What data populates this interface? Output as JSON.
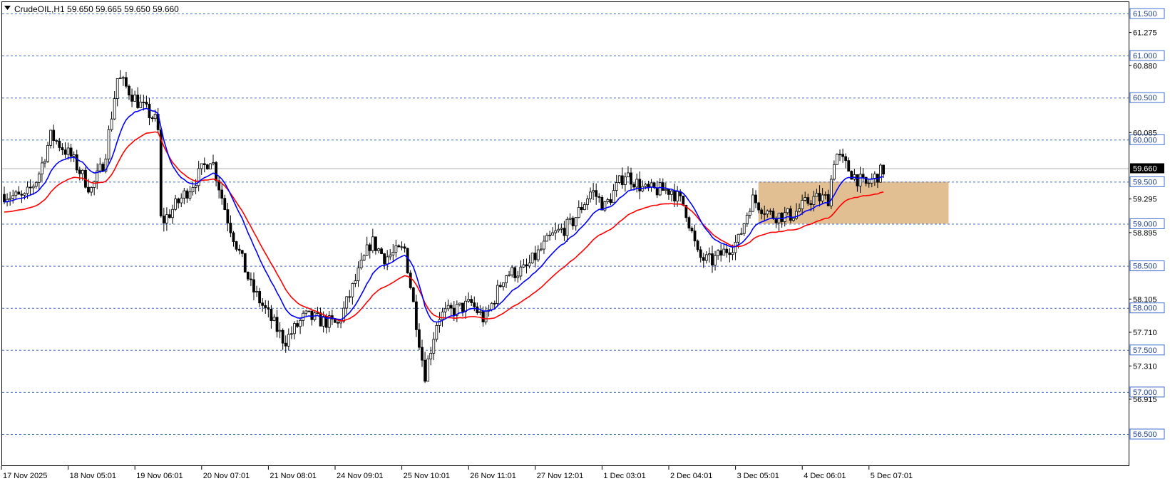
{
  "header": {
    "title": "CrudeOIL,H1  59.650 59.665 59.650 59.660"
  },
  "colors": {
    "background": "#ffffff",
    "candle_body": "#000000",
    "fast_ma": "#0000ff",
    "slow_ma": "#ff0000",
    "level_line": "#3f6fd1",
    "zone_fill": "#deb887",
    "current_price_label_bg": "#000000"
  },
  "chart_data": {
    "type": "candlestick",
    "symbol": "CrudeOIL",
    "timeframe": "H1",
    "ohlc_header": {
      "open": 59.65,
      "high": 59.665,
      "low": 59.65,
      "close": 59.66
    },
    "current_price": 59.66,
    "ylim": [
      56.4,
      61.6
    ],
    "y_tick_labels": [
      "61.275",
      "60.880",
      "60.085",
      "59.295",
      "58.895",
      "58.105",
      "57.710",
      "57.310",
      "56.915"
    ],
    "level_lines": [
      "61.500",
      "61.000",
      "60.500",
      "60.000",
      "59.500",
      "59.000",
      "58.500",
      "58.000",
      "57.500",
      "57.000",
      "56.500"
    ],
    "x_tick_labels": [
      "17 Nov 2025",
      "18 Nov 05:01",
      "19 Nov 06:01",
      "20 Nov 07:01",
      "21 Nov 08:01",
      "24 Nov 09:01",
      "25 Nov 10:01",
      "26 Nov 11:01",
      "27 Nov 12:01",
      "1 Dec 03:01",
      "2 Dec 04:01",
      "3 Dec 05:01",
      "4 Dec 06:01",
      "5 Dec 07:01"
    ],
    "grid": false,
    "zone": {
      "from": "3 Dec 12:01",
      "to": "6 Dec 07:01",
      "low": 59.0,
      "high": 59.5
    },
    "close_path": [
      {
        "t": 0,
        "v": 59.35
      },
      {
        "t": 0.3,
        "v": 59.3
      },
      {
        "t": 0.5,
        "v": 59.55
      },
      {
        "t": 0.7,
        "v": 60.05
      },
      {
        "t": 1.0,
        "v": 59.8
      },
      {
        "t": 1.3,
        "v": 59.4
      },
      {
        "t": 1.5,
        "v": 59.75
      },
      {
        "t": 1.7,
        "v": 60.75
      },
      {
        "t": 2.0,
        "v": 60.45
      },
      {
        "t": 2.3,
        "v": 60.2
      },
      {
        "t": 2.35,
        "v": 59.0
      },
      {
        "t": 2.5,
        "v": 59.15
      },
      {
        "t": 2.8,
        "v": 59.45
      },
      {
        "t": 3.1,
        "v": 59.8
      },
      {
        "t": 3.35,
        "v": 59.05
      },
      {
        "t": 3.7,
        "v": 58.25
      },
      {
        "t": 4.2,
        "v": 57.6
      },
      {
        "t": 4.5,
        "v": 57.9
      },
      {
        "t": 5.0,
        "v": 57.8
      },
      {
        "t": 5.2,
        "v": 58.2
      },
      {
        "t": 5.5,
        "v": 58.8
      },
      {
        "t": 5.7,
        "v": 58.6
      },
      {
        "t": 6.0,
        "v": 58.7
      },
      {
        "t": 6.3,
        "v": 57.2
      },
      {
        "t": 6.5,
        "v": 57.9
      },
      {
        "t": 7.0,
        "v": 58.05
      },
      {
        "t": 7.2,
        "v": 57.85
      },
      {
        "t": 7.5,
        "v": 58.4
      },
      {
        "t": 7.8,
        "v": 58.45
      },
      {
        "t": 8.2,
        "v": 58.85
      },
      {
        "t": 8.5,
        "v": 59.0
      },
      {
        "t": 8.8,
        "v": 59.4
      },
      {
        "t": 9.0,
        "v": 59.2
      },
      {
        "t": 9.3,
        "v": 59.6
      },
      {
        "t": 9.6,
        "v": 59.4
      },
      {
        "t": 10.0,
        "v": 59.4
      },
      {
        "t": 10.2,
        "v": 59.2
      },
      {
        "t": 10.4,
        "v": 58.6
      },
      {
        "t": 10.6,
        "v": 58.55
      },
      {
        "t": 11.0,
        "v": 58.8
      },
      {
        "t": 11.2,
        "v": 59.3
      },
      {
        "t": 11.5,
        "v": 59.1
      },
      {
        "t": 11.8,
        "v": 59.1
      },
      {
        "t": 12.1,
        "v": 59.3
      },
      {
        "t": 12.35,
        "v": 59.3
      },
      {
        "t": 12.45,
        "v": 59.85
      },
      {
        "t": 12.7,
        "v": 59.6
      },
      {
        "t": 12.9,
        "v": 59.45
      },
      {
        "t": 13.2,
        "v": 59.66
      }
    ]
  }
}
